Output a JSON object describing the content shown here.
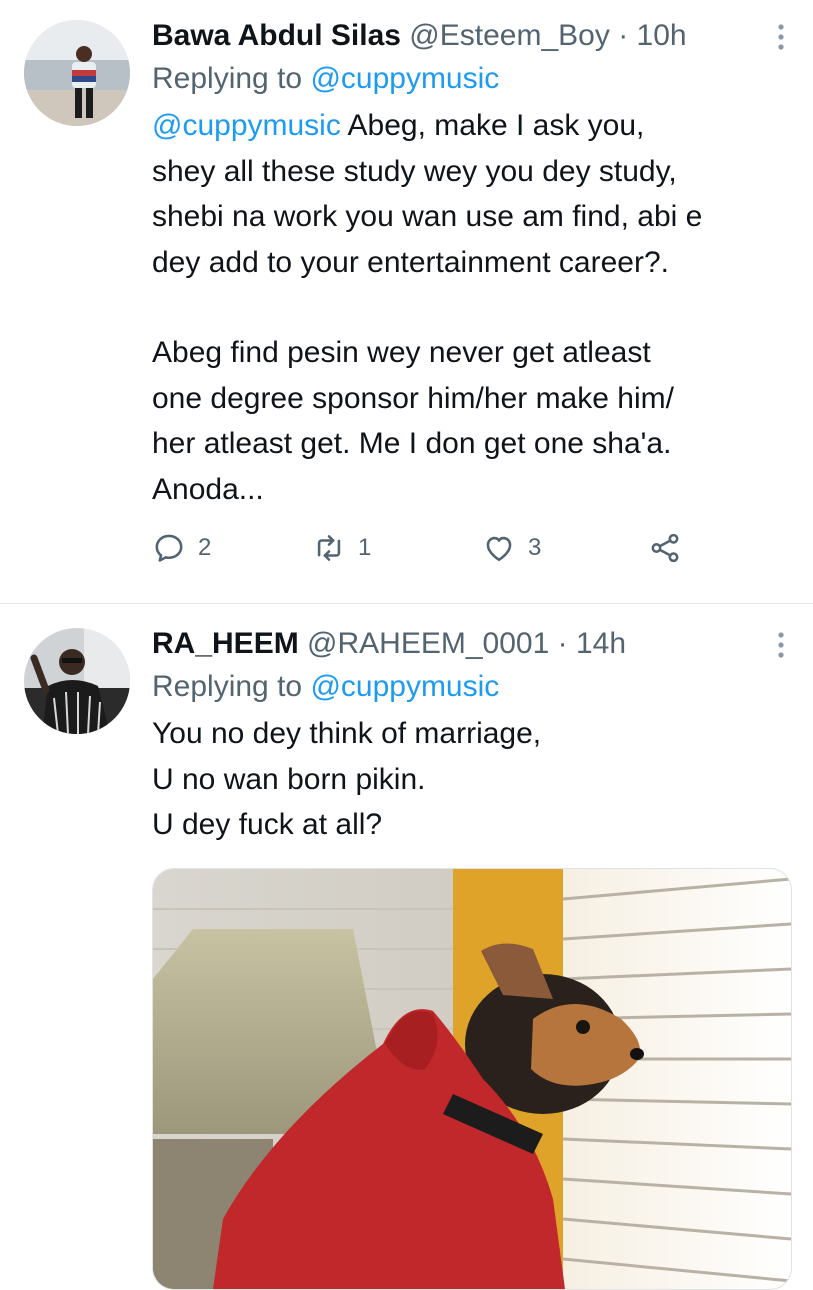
{
  "tweets": [
    {
      "name": "Bawa Abdul Silas",
      "handle": "@Esteem_Boy",
      "separator": "·",
      "time": "10h",
      "replying_prefix": "Replying to",
      "replying_handle": "@cuppymusic",
      "body_mention": "@cuppymusic",
      "lines": [
        "Abeg, make I ask you,",
        "shey all these study wey you dey study,",
        "shebi na work you wan use am find, abi e",
        "dey add to your entertainment career?.",
        "",
        "Abeg find pesin wey never get atleast",
        "one degree sponsor him/her make him/",
        "her atleast get. Me I don get one sha'a.",
        "Anoda..."
      ],
      "actions": {
        "reply_count": "2",
        "retweet_count": "1",
        "like_count": "3"
      }
    },
    {
      "name": "RA_HEEM",
      "handle": "@RAHEEM_0001",
      "separator": "·",
      "time": "14h",
      "replying_prefix": "Replying to",
      "replying_handle": "@cuppymusic",
      "lines": [
        "You no dey think of marriage,",
        "U no wan born pikin.",
        "U dey fuck at all?"
      ]
    }
  ],
  "icons": {
    "more": "more-vertical-icon",
    "reply": "reply-icon",
    "retweet": "retweet-icon",
    "like": "heart-icon",
    "share": "share-icon"
  },
  "colors": {
    "link": "#1d9bf0",
    "secondary_text": "#536471",
    "primary_text": "#0f1419",
    "divider": "#e5e8eb"
  }
}
